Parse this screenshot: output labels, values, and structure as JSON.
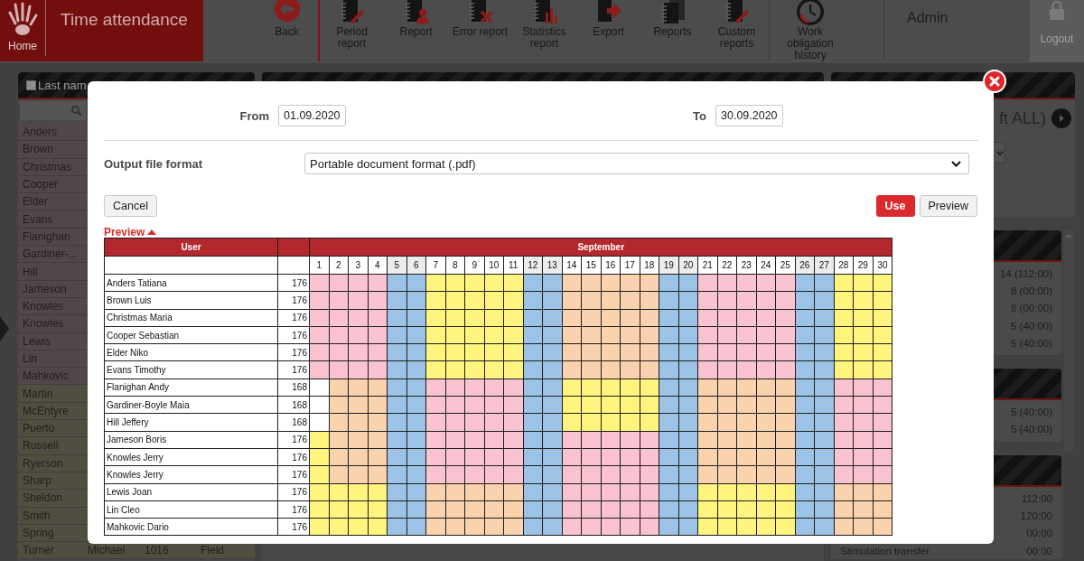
{
  "top_bar": {
    "home_label": "Home",
    "app_title": "Time attendance",
    "tool_groups": [
      {
        "tools": [
          {
            "label": "Back",
            "kind": "back"
          }
        ]
      },
      {
        "tools": [
          {
            "label": "Period report",
            "kind": "notebook-pen"
          },
          {
            "label": "Report",
            "kind": "notebook-person"
          },
          {
            "label": "Error report",
            "kind": "notebook-x"
          },
          {
            "label": "Statistics report",
            "kind": "notebook-chart"
          },
          {
            "label": "Export",
            "kind": "export"
          },
          {
            "label": "Reports",
            "kind": "notebooks"
          },
          {
            "label": "Custom reports",
            "kind": "notebook-pen"
          }
        ]
      },
      {
        "tools": [
          {
            "label": "Work obligation history",
            "kind": "clock"
          }
        ]
      }
    ],
    "user": "Admin",
    "logout": "Logout"
  },
  "user_list": {
    "heading": "Last nam",
    "select_all_checked": false,
    "rows": [
      {
        "last_name": "Anders",
        "color": "#524748"
      },
      {
        "last_name": "Brown",
        "color": "#524748"
      },
      {
        "last_name": "Christmas",
        "color": "#524748"
      },
      {
        "last_name": "Cooper",
        "color": "#524748"
      },
      {
        "last_name": "Elder",
        "color": "#524748"
      },
      {
        "last_name": "Evans",
        "color": "#524748"
      },
      {
        "last_name": "Flanighan",
        "color": "#524748"
      },
      {
        "last_name": "Gardiner-...",
        "color": "#524748"
      },
      {
        "last_name": "Hill",
        "color": "#524748"
      },
      {
        "last_name": "Jameson",
        "color": "#524748"
      },
      {
        "last_name": "Knowles",
        "color": "#524748"
      },
      {
        "last_name": "Knowles",
        "color": "#524748"
      },
      {
        "last_name": "Lewis",
        "color": "#524748"
      },
      {
        "last_name": "Lin",
        "color": "#524748"
      },
      {
        "last_name": "Mahkovic",
        "color": "#524748"
      },
      {
        "last_name": "Martin",
        "color": "#504f3f"
      },
      {
        "last_name": "McEntyre",
        "color": "#504f3f"
      },
      {
        "last_name": "Puerto",
        "color": "#504f3f"
      },
      {
        "last_name": "Russell",
        "color": "#504f3f"
      },
      {
        "last_name": "Ryerson",
        "color": "#504f3f"
      },
      {
        "last_name": "Sharp",
        "color": "#504f3f"
      },
      {
        "last_name": "Sheldon",
        "color": "#504f3f"
      },
      {
        "last_name": "Smith",
        "color": "#504f3f"
      },
      {
        "last_name": "Spring",
        "color": "#504f3f"
      },
      {
        "last_name": "Turner",
        "first_name": "Michael",
        "column_3": "1016",
        "column_4": "Field",
        "color": "#504f3f"
      }
    ]
  },
  "right_panel": {
    "filter_text": "ft ALL)",
    "summary_panels": [
      {
        "rows": [
          {
            "value": "14 (112:00)"
          },
          {
            "value": "8 (00:00)"
          },
          {
            "value": "8 (00:00)"
          },
          {
            "value": "5 (40:00)"
          },
          {
            "value": "5 (40:00)"
          }
        ]
      },
      {
        "rows": [
          {
            "value": "5 (40:00)"
          },
          {
            "value": "5 (40:00)"
          }
        ]
      },
      {
        "rows": [
          {
            "value": "112:00"
          },
          {
            "value": "120:00"
          },
          {
            "value": "00:00"
          },
          {
            "label": "Stimulation transfer",
            "value": "00:00"
          }
        ]
      }
    ]
  },
  "dialog": {
    "from": {
      "label": "From",
      "value": "01.09.2020"
    },
    "to": {
      "label": "To",
      "value": "30.09.2020"
    },
    "output_format": {
      "label": "Output file format",
      "value": "Portable document format (.pdf)"
    },
    "buttons": [
      {
        "label": "Cancel",
        "kind": "cancel"
      },
      {
        "label": "Use",
        "kind": "primary"
      },
      {
        "label": "Preview",
        "kind": "default"
      }
    ],
    "preview_toggle": {
      "label": "Preview",
      "expanded": true
    },
    "table": {
      "user_heading": "User",
      "month_heading": "September",
      "days": [
        {
          "label": "1",
          "shaded": false
        },
        {
          "label": "2",
          "shaded": false
        },
        {
          "label": "3",
          "shaded": false
        },
        {
          "label": "4",
          "shaded": false
        },
        {
          "label": "5",
          "shaded": true
        },
        {
          "label": "6",
          "shaded": true
        },
        {
          "label": "7",
          "shaded": false
        },
        {
          "label": "8",
          "shaded": false
        },
        {
          "label": "9",
          "shaded": false
        },
        {
          "label": "10",
          "shaded": false
        },
        {
          "label": "11",
          "shaded": false
        },
        {
          "label": "12",
          "shaded": true
        },
        {
          "label": "13",
          "shaded": true
        },
        {
          "label": "14",
          "shaded": false
        },
        {
          "label": "15",
          "shaded": false
        },
        {
          "label": "16",
          "shaded": false
        },
        {
          "label": "17",
          "shaded": false
        },
        {
          "label": "18",
          "shaded": false
        },
        {
          "label": "19",
          "shaded": true
        },
        {
          "label": "20",
          "shaded": true
        },
        {
          "label": "21",
          "shaded": false
        },
        {
          "label": "22",
          "shaded": false
        },
        {
          "label": "23",
          "shaded": false
        },
        {
          "label": "24",
          "shaded": false
        },
        {
          "label": "25",
          "shaded": false
        },
        {
          "label": "26",
          "shaded": true
        },
        {
          "label": "27",
          "shaded": true
        },
        {
          "label": "28",
          "shaded": false
        },
        {
          "label": "29",
          "shaded": false
        },
        {
          "label": "30",
          "shaded": false
        }
      ],
      "rows": [
        {
          "name": "Anders Tatiana",
          "hours": "176",
          "cells": [
            {
              "color": "#f9c3cf"
            },
            {
              "color": "#f9c3cf"
            },
            {
              "color": "#f9c3cf"
            },
            {
              "color": "#f9c3cf"
            },
            {
              "color": "#9cc3e5"
            },
            {
              "color": "#9cc3e5"
            },
            {
              "color": "#fef47e"
            },
            {
              "color": "#fef47e"
            },
            {
              "color": "#fef47e"
            },
            {
              "color": "#fef47e"
            },
            {
              "color": "#fef47e"
            },
            {
              "color": "#9cc3e5"
            },
            {
              "color": "#9cc3e5"
            },
            {
              "color": "#fad2ad"
            },
            {
              "color": "#fad2ad"
            },
            {
              "color": "#fad2ad"
            },
            {
              "color": "#fad2ad"
            },
            {
              "color": "#fad2ad"
            },
            {
              "color": "#9cc3e5"
            },
            {
              "color": "#9cc3e5"
            },
            {
              "color": "#f9c3cf"
            },
            {
              "color": "#f9c3cf"
            },
            {
              "color": "#f9c3cf"
            },
            {
              "color": "#f9c3cf"
            },
            {
              "color": "#f9c3cf"
            },
            {
              "color": "#9cc3e5"
            },
            {
              "color": "#9cc3e5"
            },
            {
              "color": "#fef47e"
            },
            {
              "color": "#fef47e"
            },
            {
              "color": "#fef47e"
            }
          ]
        },
        {
          "name": "Brown Luis",
          "hours": "176",
          "cells": [
            {
              "color": "#f9c3cf"
            },
            {
              "color": "#f9c3cf"
            },
            {
              "color": "#f9c3cf"
            },
            {
              "color": "#f9c3cf"
            },
            {
              "color": "#9cc3e5"
            },
            {
              "color": "#9cc3e5"
            },
            {
              "color": "#fef47e"
            },
            {
              "color": "#fef47e"
            },
            {
              "color": "#fef47e"
            },
            {
              "color": "#fef47e"
            },
            {
              "color": "#fef47e"
            },
            {
              "color": "#9cc3e5"
            },
            {
              "color": "#9cc3e5"
            },
            {
              "color": "#fad2ad"
            },
            {
              "color": "#fad2ad"
            },
            {
              "color": "#fad2ad"
            },
            {
              "color": "#fad2ad"
            },
            {
              "color": "#fad2ad"
            },
            {
              "color": "#9cc3e5"
            },
            {
              "color": "#9cc3e5"
            },
            {
              "color": "#f9c3cf"
            },
            {
              "color": "#f9c3cf"
            },
            {
              "color": "#f9c3cf"
            },
            {
              "color": "#f9c3cf"
            },
            {
              "color": "#f9c3cf"
            },
            {
              "color": "#9cc3e5"
            },
            {
              "color": "#9cc3e5"
            },
            {
              "color": "#fef47e"
            },
            {
              "color": "#fef47e"
            },
            {
              "color": "#fef47e"
            }
          ]
        },
        {
          "name": "Christmas Maria",
          "hours": "176",
          "cells": [
            {
              "color": "#f9c3cf"
            },
            {
              "color": "#f9c3cf"
            },
            {
              "color": "#f9c3cf"
            },
            {
              "color": "#f9c3cf"
            },
            {
              "color": "#9cc3e5"
            },
            {
              "color": "#9cc3e5"
            },
            {
              "color": "#fef47e"
            },
            {
              "color": "#fef47e"
            },
            {
              "color": "#fef47e"
            },
            {
              "color": "#fef47e"
            },
            {
              "color": "#fef47e"
            },
            {
              "color": "#9cc3e5"
            },
            {
              "color": "#9cc3e5"
            },
            {
              "color": "#fad2ad"
            },
            {
              "color": "#fad2ad"
            },
            {
              "color": "#fad2ad"
            },
            {
              "color": "#fad2ad"
            },
            {
              "color": "#fad2ad"
            },
            {
              "color": "#9cc3e5"
            },
            {
              "color": "#9cc3e5"
            },
            {
              "color": "#f9c3cf"
            },
            {
              "color": "#f9c3cf"
            },
            {
              "color": "#f9c3cf"
            },
            {
              "color": "#f9c3cf"
            },
            {
              "color": "#f9c3cf"
            },
            {
              "color": "#9cc3e5"
            },
            {
              "color": "#9cc3e5"
            },
            {
              "color": "#fef47e"
            },
            {
              "color": "#fef47e"
            },
            {
              "color": "#fef47e"
            }
          ]
        },
        {
          "name": "Cooper Sebastian",
          "hours": "176",
          "cells": [
            {
              "color": "#f9c3cf"
            },
            {
              "color": "#f9c3cf"
            },
            {
              "color": "#f9c3cf"
            },
            {
              "color": "#f9c3cf"
            },
            {
              "color": "#9cc3e5"
            },
            {
              "color": "#9cc3e5"
            },
            {
              "color": "#fef47e"
            },
            {
              "color": "#fef47e"
            },
            {
              "color": "#fef47e"
            },
            {
              "color": "#fef47e"
            },
            {
              "color": "#fef47e"
            },
            {
              "color": "#9cc3e5"
            },
            {
              "color": "#9cc3e5"
            },
            {
              "color": "#fad2ad"
            },
            {
              "color": "#fad2ad"
            },
            {
              "color": "#fad2ad"
            },
            {
              "color": "#fad2ad"
            },
            {
              "color": "#fad2ad"
            },
            {
              "color": "#9cc3e5"
            },
            {
              "color": "#9cc3e5"
            },
            {
              "color": "#f9c3cf"
            },
            {
              "color": "#f9c3cf"
            },
            {
              "color": "#f9c3cf"
            },
            {
              "color": "#f9c3cf"
            },
            {
              "color": "#f9c3cf"
            },
            {
              "color": "#9cc3e5"
            },
            {
              "color": "#9cc3e5"
            },
            {
              "color": "#fef47e"
            },
            {
              "color": "#fef47e"
            },
            {
              "color": "#fef47e"
            }
          ]
        },
        {
          "name": "Elder Niko",
          "hours": "176",
          "cells": [
            {
              "color": "#f9c3cf"
            },
            {
              "color": "#f9c3cf"
            },
            {
              "color": "#f9c3cf"
            },
            {
              "color": "#f9c3cf"
            },
            {
              "color": "#9cc3e5"
            },
            {
              "color": "#9cc3e5"
            },
            {
              "color": "#fef47e"
            },
            {
              "color": "#fef47e"
            },
            {
              "color": "#fef47e"
            },
            {
              "color": "#fef47e"
            },
            {
              "color": "#fef47e"
            },
            {
              "color": "#9cc3e5"
            },
            {
              "color": "#9cc3e5"
            },
            {
              "color": "#fad2ad"
            },
            {
              "color": "#fad2ad"
            },
            {
              "color": "#fad2ad"
            },
            {
              "color": "#fad2ad"
            },
            {
              "color": "#fad2ad"
            },
            {
              "color": "#9cc3e5"
            },
            {
              "color": "#9cc3e5"
            },
            {
              "color": "#f9c3cf"
            },
            {
              "color": "#f9c3cf"
            },
            {
              "color": "#f9c3cf"
            },
            {
              "color": "#f9c3cf"
            },
            {
              "color": "#f9c3cf"
            },
            {
              "color": "#9cc3e5"
            },
            {
              "color": "#9cc3e5"
            },
            {
              "color": "#fef47e"
            },
            {
              "color": "#fef47e"
            },
            {
              "color": "#fef47e"
            }
          ]
        },
        {
          "name": "Evans Timothy",
          "hours": "176",
          "cells": [
            {
              "color": "#f9c3cf"
            },
            {
              "color": "#f9c3cf"
            },
            {
              "color": "#f9c3cf"
            },
            {
              "color": "#f9c3cf"
            },
            {
              "color": "#9cc3e5"
            },
            {
              "color": "#9cc3e5"
            },
            {
              "color": "#fef47e"
            },
            {
              "color": "#fef47e"
            },
            {
              "color": "#fef47e"
            },
            {
              "color": "#fef47e"
            },
            {
              "color": "#fef47e"
            },
            {
              "color": "#9cc3e5"
            },
            {
              "color": "#9cc3e5"
            },
            {
              "color": "#fad2ad"
            },
            {
              "color": "#fad2ad"
            },
            {
              "color": "#fad2ad"
            },
            {
              "color": "#fad2ad"
            },
            {
              "color": "#fad2ad"
            },
            {
              "color": "#9cc3e5"
            },
            {
              "color": "#9cc3e5"
            },
            {
              "color": "#f9c3cf"
            },
            {
              "color": "#f9c3cf"
            },
            {
              "color": "#f9c3cf"
            },
            {
              "color": "#f9c3cf"
            },
            {
              "color": "#f9c3cf"
            },
            {
              "color": "#9cc3e5"
            },
            {
              "color": "#9cc3e5"
            },
            {
              "color": "#fef47e"
            },
            {
              "color": "#fef47e"
            },
            {
              "color": "#fef47e"
            }
          ]
        },
        {
          "name": "Flanighan Andy",
          "hours": "168",
          "cells": [
            {
              "color": "#ffffff"
            },
            {
              "color": "#fad2ad"
            },
            {
              "color": "#fad2ad"
            },
            {
              "color": "#fad2ad"
            },
            {
              "color": "#9cc3e5"
            },
            {
              "color": "#9cc3e5"
            },
            {
              "color": "#f9c3cf"
            },
            {
              "color": "#f9c3cf"
            },
            {
              "color": "#f9c3cf"
            },
            {
              "color": "#f9c3cf"
            },
            {
              "color": "#f9c3cf"
            },
            {
              "color": "#9cc3e5"
            },
            {
              "color": "#9cc3e5"
            },
            {
              "color": "#fef47e"
            },
            {
              "color": "#fef47e"
            },
            {
              "color": "#fef47e"
            },
            {
              "color": "#fef47e"
            },
            {
              "color": "#fef47e"
            },
            {
              "color": "#9cc3e5"
            },
            {
              "color": "#9cc3e5"
            },
            {
              "color": "#fad2ad"
            },
            {
              "color": "#fad2ad"
            },
            {
              "color": "#fad2ad"
            },
            {
              "color": "#fad2ad"
            },
            {
              "color": "#fad2ad"
            },
            {
              "color": "#9cc3e5"
            },
            {
              "color": "#9cc3e5"
            },
            {
              "color": "#f9c3cf"
            },
            {
              "color": "#f9c3cf"
            },
            {
              "color": "#f9c3cf"
            }
          ]
        },
        {
          "name": "Gardiner-Boyle Maia",
          "hours": "168",
          "cells": [
            {
              "color": "#ffffff"
            },
            {
              "color": "#fad2ad"
            },
            {
              "color": "#fad2ad"
            },
            {
              "color": "#fad2ad"
            },
            {
              "color": "#9cc3e5"
            },
            {
              "color": "#9cc3e5"
            },
            {
              "color": "#f9c3cf"
            },
            {
              "color": "#f9c3cf"
            },
            {
              "color": "#f9c3cf"
            },
            {
              "color": "#f9c3cf"
            },
            {
              "color": "#f9c3cf"
            },
            {
              "color": "#9cc3e5"
            },
            {
              "color": "#9cc3e5"
            },
            {
              "color": "#fef47e"
            },
            {
              "color": "#fef47e"
            },
            {
              "color": "#fef47e"
            },
            {
              "color": "#fef47e"
            },
            {
              "color": "#fef47e"
            },
            {
              "color": "#9cc3e5"
            },
            {
              "color": "#9cc3e5"
            },
            {
              "color": "#fad2ad"
            },
            {
              "color": "#fad2ad"
            },
            {
              "color": "#fad2ad"
            },
            {
              "color": "#fad2ad"
            },
            {
              "color": "#fad2ad"
            },
            {
              "color": "#9cc3e5"
            },
            {
              "color": "#9cc3e5"
            },
            {
              "color": "#f9c3cf"
            },
            {
              "color": "#f9c3cf"
            },
            {
              "color": "#f9c3cf"
            }
          ]
        },
        {
          "name": "Hill Jeffery",
          "hours": "168",
          "cells": [
            {
              "color": "#ffffff"
            },
            {
              "color": "#fad2ad"
            },
            {
              "color": "#fad2ad"
            },
            {
              "color": "#fad2ad"
            },
            {
              "color": "#9cc3e5"
            },
            {
              "color": "#9cc3e5"
            },
            {
              "color": "#f9c3cf"
            },
            {
              "color": "#f9c3cf"
            },
            {
              "color": "#f9c3cf"
            },
            {
              "color": "#f9c3cf"
            },
            {
              "color": "#f9c3cf"
            },
            {
              "color": "#9cc3e5"
            },
            {
              "color": "#9cc3e5"
            },
            {
              "color": "#fef47e"
            },
            {
              "color": "#fef47e"
            },
            {
              "color": "#fef47e"
            },
            {
              "color": "#fef47e"
            },
            {
              "color": "#fef47e"
            },
            {
              "color": "#9cc3e5"
            },
            {
              "color": "#9cc3e5"
            },
            {
              "color": "#fad2ad"
            },
            {
              "color": "#fad2ad"
            },
            {
              "color": "#fad2ad"
            },
            {
              "color": "#fad2ad"
            },
            {
              "color": "#fad2ad"
            },
            {
              "color": "#9cc3e5"
            },
            {
              "color": "#9cc3e5"
            },
            {
              "color": "#f9c3cf"
            },
            {
              "color": "#f9c3cf"
            },
            {
              "color": "#f9c3cf"
            }
          ]
        },
        {
          "name": "Jameson Boris",
          "hours": "176",
          "cells": [
            {
              "color": "#fef47e"
            },
            {
              "color": "#fad2ad"
            },
            {
              "color": "#fad2ad"
            },
            {
              "color": "#fad2ad"
            },
            {
              "color": "#9cc3e5"
            },
            {
              "color": "#9cc3e5"
            },
            {
              "color": "#f9c3cf"
            },
            {
              "color": "#f9c3cf"
            },
            {
              "color": "#f9c3cf"
            },
            {
              "color": "#f9c3cf"
            },
            {
              "color": "#f9c3cf"
            },
            {
              "color": "#9cc3e5"
            },
            {
              "color": "#9cc3e5"
            },
            {
              "color": "#f9c3cf"
            },
            {
              "color": "#f9c3cf"
            },
            {
              "color": "#f9c3cf"
            },
            {
              "color": "#f9c3cf"
            },
            {
              "color": "#f9c3cf"
            },
            {
              "color": "#9cc3e5"
            },
            {
              "color": "#9cc3e5"
            },
            {
              "color": "#fad2ad"
            },
            {
              "color": "#fad2ad"
            },
            {
              "color": "#fad2ad"
            },
            {
              "color": "#fad2ad"
            },
            {
              "color": "#fad2ad"
            },
            {
              "color": "#9cc3e5"
            },
            {
              "color": "#9cc3e5"
            },
            {
              "color": "#f9c3cf"
            },
            {
              "color": "#f9c3cf"
            },
            {
              "color": "#f9c3cf"
            }
          ]
        },
        {
          "name": "Knowles Jerry",
          "hours": "176",
          "cells": [
            {
              "color": "#fef47e"
            },
            {
              "color": "#fad2ad"
            },
            {
              "color": "#fad2ad"
            },
            {
              "color": "#fad2ad"
            },
            {
              "color": "#9cc3e5"
            },
            {
              "color": "#9cc3e5"
            },
            {
              "color": "#f9c3cf"
            },
            {
              "color": "#f9c3cf"
            },
            {
              "color": "#f9c3cf"
            },
            {
              "color": "#f9c3cf"
            },
            {
              "color": "#f9c3cf"
            },
            {
              "color": "#9cc3e5"
            },
            {
              "color": "#9cc3e5"
            },
            {
              "color": "#f9c3cf"
            },
            {
              "color": "#f9c3cf"
            },
            {
              "color": "#f9c3cf"
            },
            {
              "color": "#f9c3cf"
            },
            {
              "color": "#f9c3cf"
            },
            {
              "color": "#9cc3e5"
            },
            {
              "color": "#9cc3e5"
            },
            {
              "color": "#fad2ad"
            },
            {
              "color": "#fad2ad"
            },
            {
              "color": "#fad2ad"
            },
            {
              "color": "#fad2ad"
            },
            {
              "color": "#fad2ad"
            },
            {
              "color": "#9cc3e5"
            },
            {
              "color": "#9cc3e5"
            },
            {
              "color": "#f9c3cf"
            },
            {
              "color": "#f9c3cf"
            },
            {
              "color": "#f9c3cf"
            }
          ]
        },
        {
          "name": "Knowles Jerry",
          "hours": "176",
          "cells": [
            {
              "color": "#fef47e"
            },
            {
              "color": "#fad2ad"
            },
            {
              "color": "#fad2ad"
            },
            {
              "color": "#fad2ad"
            },
            {
              "color": "#9cc3e5"
            },
            {
              "color": "#9cc3e5"
            },
            {
              "color": "#f9c3cf"
            },
            {
              "color": "#f9c3cf"
            },
            {
              "color": "#f9c3cf"
            },
            {
              "color": "#f9c3cf"
            },
            {
              "color": "#f9c3cf"
            },
            {
              "color": "#9cc3e5"
            },
            {
              "color": "#9cc3e5"
            },
            {
              "color": "#f9c3cf"
            },
            {
              "color": "#f9c3cf"
            },
            {
              "color": "#f9c3cf"
            },
            {
              "color": "#f9c3cf"
            },
            {
              "color": "#f9c3cf"
            },
            {
              "color": "#9cc3e5"
            },
            {
              "color": "#9cc3e5"
            },
            {
              "color": "#fad2ad"
            },
            {
              "color": "#fad2ad"
            },
            {
              "color": "#fad2ad"
            },
            {
              "color": "#fad2ad"
            },
            {
              "color": "#fad2ad"
            },
            {
              "color": "#9cc3e5"
            },
            {
              "color": "#9cc3e5"
            },
            {
              "color": "#f9c3cf"
            },
            {
              "color": "#f9c3cf"
            },
            {
              "color": "#f9c3cf"
            }
          ]
        },
        {
          "name": "Lewis Joan",
          "hours": "176",
          "cells": [
            {
              "color": "#fef47e"
            },
            {
              "color": "#fef47e"
            },
            {
              "color": "#fef47e"
            },
            {
              "color": "#fef47e"
            },
            {
              "color": "#9cc3e5"
            },
            {
              "color": "#9cc3e5"
            },
            {
              "color": "#fad2ad"
            },
            {
              "color": "#fad2ad"
            },
            {
              "color": "#fad2ad"
            },
            {
              "color": "#fad2ad"
            },
            {
              "color": "#fad2ad"
            },
            {
              "color": "#9cc3e5"
            },
            {
              "color": "#9cc3e5"
            },
            {
              "color": "#f9c3cf"
            },
            {
              "color": "#f9c3cf"
            },
            {
              "color": "#f9c3cf"
            },
            {
              "color": "#f9c3cf"
            },
            {
              "color": "#f9c3cf"
            },
            {
              "color": "#9cc3e5"
            },
            {
              "color": "#9cc3e5"
            },
            {
              "color": "#fef47e"
            },
            {
              "color": "#fef47e"
            },
            {
              "color": "#fef47e"
            },
            {
              "color": "#fef47e"
            },
            {
              "color": "#fef47e"
            },
            {
              "color": "#9cc3e5"
            },
            {
              "color": "#9cc3e5"
            },
            {
              "color": "#fad2ad"
            },
            {
              "color": "#fad2ad"
            },
            {
              "color": "#fad2ad"
            }
          ]
        },
        {
          "name": "Lin Cleo",
          "hours": "176",
          "cells": [
            {
              "color": "#fef47e"
            },
            {
              "color": "#fef47e"
            },
            {
              "color": "#fef47e"
            },
            {
              "color": "#fef47e"
            },
            {
              "color": "#9cc3e5"
            },
            {
              "color": "#9cc3e5"
            },
            {
              "color": "#fad2ad"
            },
            {
              "color": "#fad2ad"
            },
            {
              "color": "#fad2ad"
            },
            {
              "color": "#fad2ad"
            },
            {
              "color": "#fad2ad"
            },
            {
              "color": "#9cc3e5"
            },
            {
              "color": "#9cc3e5"
            },
            {
              "color": "#f9c3cf"
            },
            {
              "color": "#f9c3cf"
            },
            {
              "color": "#f9c3cf"
            },
            {
              "color": "#f9c3cf"
            },
            {
              "color": "#f9c3cf"
            },
            {
              "color": "#9cc3e5"
            },
            {
              "color": "#9cc3e5"
            },
            {
              "color": "#fef47e"
            },
            {
              "color": "#fef47e"
            },
            {
              "color": "#fef47e"
            },
            {
              "color": "#fef47e"
            },
            {
              "color": "#fef47e"
            },
            {
              "color": "#9cc3e5"
            },
            {
              "color": "#9cc3e5"
            },
            {
              "color": "#fad2ad"
            },
            {
              "color": "#fad2ad"
            },
            {
              "color": "#fad2ad"
            }
          ]
        },
        {
          "name": "Mahkovic Dario",
          "hours": "176",
          "cells": [
            {
              "color": "#fef47e"
            },
            {
              "color": "#fef47e"
            },
            {
              "color": "#fef47e"
            },
            {
              "color": "#fef47e"
            },
            {
              "color": "#9cc3e5"
            },
            {
              "color": "#9cc3e5"
            },
            {
              "color": "#fad2ad"
            },
            {
              "color": "#fad2ad"
            },
            {
              "color": "#fad2ad"
            },
            {
              "color": "#fad2ad"
            },
            {
              "color": "#fad2ad"
            },
            {
              "color": "#9cc3e5"
            },
            {
              "color": "#9cc3e5"
            },
            {
              "color": "#f9c3cf"
            },
            {
              "color": "#f9c3cf"
            },
            {
              "color": "#f9c3cf"
            },
            {
              "color": "#f9c3cf"
            },
            {
              "color": "#f9c3cf"
            },
            {
              "color": "#9cc3e5"
            },
            {
              "color": "#9cc3e5"
            },
            {
              "color": "#fef47e"
            },
            {
              "color": "#fef47e"
            },
            {
              "color": "#fef47e"
            },
            {
              "color": "#fef47e"
            },
            {
              "color": "#fef47e"
            },
            {
              "color": "#9cc3e5"
            },
            {
              "color": "#9cc3e5"
            },
            {
              "color": "#fad2ad"
            },
            {
              "color": "#fad2ad"
            },
            {
              "color": "#fad2ad"
            }
          ]
        }
      ]
    }
  }
}
